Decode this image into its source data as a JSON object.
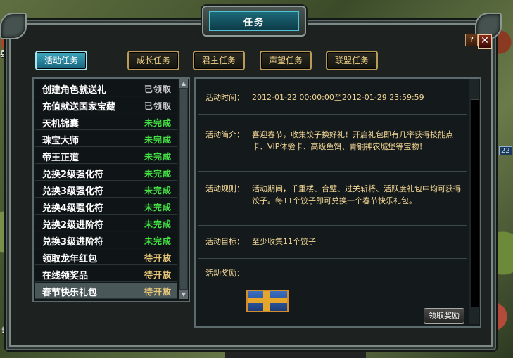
{
  "window": {
    "title": "任务",
    "help_label": "?",
    "close_label": "✕"
  },
  "world": {
    "label_top_left": "县关舒",
    "label_bottom_left": "城北",
    "badge_right": "22"
  },
  "tabs": [
    {
      "label": "活动任务",
      "active": true
    },
    {
      "label": "成长任务",
      "active": false
    },
    {
      "label": "君主任务",
      "active": false
    },
    {
      "label": "声望任务",
      "active": false
    },
    {
      "label": "联盟任务",
      "active": false
    }
  ],
  "activities": [
    {
      "name": "创建角色就送礼",
      "status": "已领取"
    },
    {
      "name": "充值就送国家宝藏",
      "status": "已领取"
    },
    {
      "name": "天机锦囊",
      "status": "未完成"
    },
    {
      "name": "珠宝大师",
      "status": "未完成"
    },
    {
      "name": "帝王正道",
      "status": "未完成"
    },
    {
      "name": "兑换2级强化符",
      "status": "未完成"
    },
    {
      "name": "兑换3级强化符",
      "status": "未完成"
    },
    {
      "name": "兑换4级强化符",
      "status": "未完成"
    },
    {
      "name": "兑换2级进阶符",
      "status": "未完成"
    },
    {
      "name": "兑换3级进阶符",
      "status": "未完成"
    },
    {
      "name": "领取龙年红包",
      "status": "待开放"
    },
    {
      "name": "在线领奖品",
      "status": "待开放"
    },
    {
      "name": "春节快乐礼包",
      "status": "待开放"
    }
  ],
  "selected_index": 12,
  "detail": {
    "time_label": "活动时间：",
    "time_value": "2012-01-22 00:00:00至2012-01-29 23:59:59",
    "intro_label": "活动简介：",
    "intro_value": "喜迎春节，收集饺子换好礼！开启礼包即有几率获得技能点卡、VIP体验卡、高级鱼饵、青铜神农城堡等宝物！",
    "rules_label": "活动规则：",
    "rules_value": "活动期间，千重楼、合璧、过关斩将、活跃度礼包中均可获得饺子。每11个饺子即可兑换一个春节快乐礼包。",
    "goal_label": "活动目标：",
    "goal_value": "至少收集11个饺子",
    "reward_label": "活动奖励：",
    "reward_icon": "gift-box-icon",
    "claim_label": "领取奖励"
  },
  "colors": {
    "status_done": "#c8c8c8",
    "status_todo": "#43e043",
    "status_wait": "#e8c878",
    "accent": "#2a8fa8"
  }
}
